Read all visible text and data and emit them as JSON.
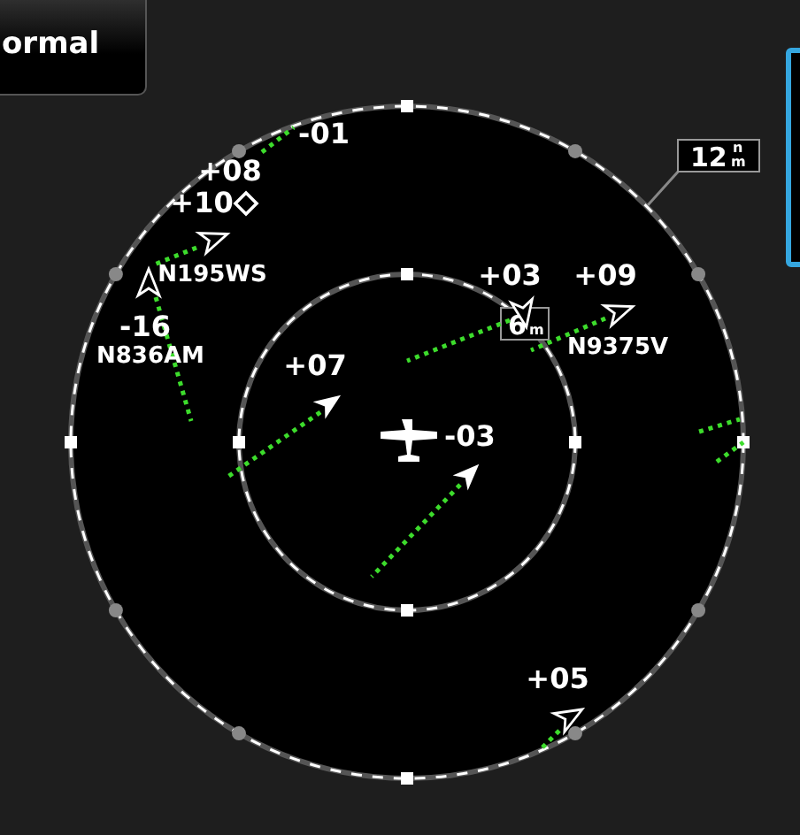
{
  "mode_button": {
    "label": "ormal"
  },
  "range": {
    "outer": {
      "value": "12",
      "unit_top": "n",
      "unit_bottom": "m"
    },
    "inner": {
      "value": "6",
      "unit_bottom": "m"
    }
  },
  "ownship": {
    "altitude": "-03"
  },
  "targets": [
    {
      "kind": "none",
      "altitude": "-01"
    },
    {
      "kind": "none",
      "altitude": "+08"
    },
    {
      "kind": "diamond",
      "altitude": "+10"
    },
    {
      "kind": "hollow",
      "callsign": "N195WS"
    },
    {
      "kind": "hollow",
      "altitude": "-16",
      "callsign": "N836AM"
    },
    {
      "kind": "filled",
      "altitude": "+07"
    },
    {
      "kind": "hollow",
      "altitude": "+03"
    },
    {
      "kind": "hollow",
      "altitude": "+09",
      "callsign": "N9375V"
    },
    {
      "kind": "filled"
    },
    {
      "kind": "hollow",
      "altitude": "+05"
    },
    {
      "kind": "none"
    },
    {
      "kind": "none"
    }
  ]
}
